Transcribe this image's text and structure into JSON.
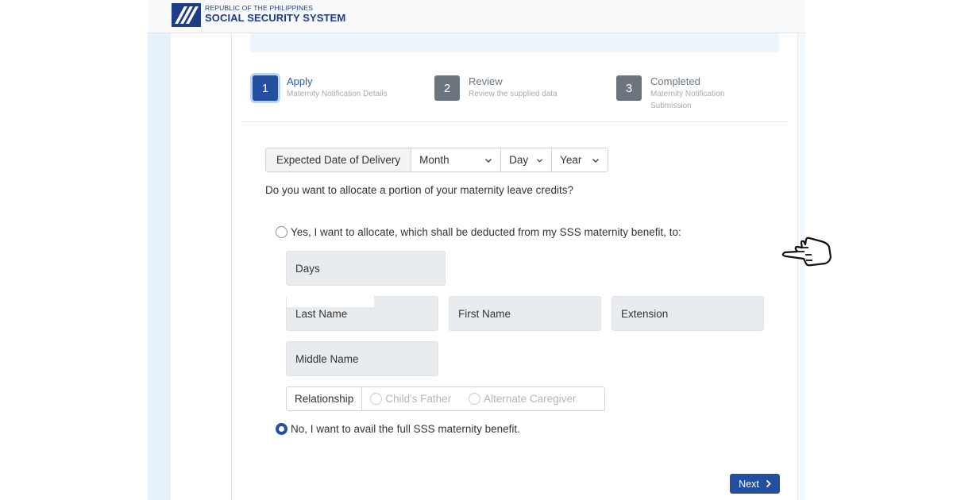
{
  "header": {
    "brand_top": "REPUBLIC OF THE PHILIPPINES",
    "brand_main": "SOCIAL SECURITY SYSTEM",
    "brand_color": "#1f3c88"
  },
  "steps": [
    {
      "number": "1",
      "title": "Apply",
      "subtitle": "Maternity Notification Details",
      "state": "active"
    },
    {
      "number": "2",
      "title": "Review",
      "subtitle": "Review the supplied data",
      "state": "inactive"
    },
    {
      "number": "3",
      "title": "Completed",
      "subtitle": "Maternity Notification Submission",
      "state": "inactive"
    }
  ],
  "edd": {
    "label": "Expected Date of Delivery",
    "month": "Month",
    "day": "Day",
    "year": "Year"
  },
  "allocation": {
    "question": "Do you want to allocate a portion of your maternity leave credits?",
    "yes_label": "Yes, I want to allocate, which shall be deducted from my SSS maternity benefit, to:",
    "no_label": "No, I want to avail the full SSS maternity benefit.",
    "selected": "no"
  },
  "fields": {
    "days": "Days",
    "last_name": "Last Name",
    "first_name": "First Name",
    "extension": "Extension",
    "middle_name": "Middle Name"
  },
  "relationship": {
    "label": "Relationship",
    "options": [
      "Child's Father",
      "Alternate Caregiver"
    ]
  },
  "actions": {
    "next_label": "Next"
  },
  "colors": {
    "primary": "#244fa0",
    "inactive_step": "#6c757d",
    "field_bg": "#e9ecef"
  },
  "icons": {
    "cursor": "pointing-hand-icon",
    "chevron": "chevron-down-icon",
    "next": "chevron-right-icon"
  }
}
